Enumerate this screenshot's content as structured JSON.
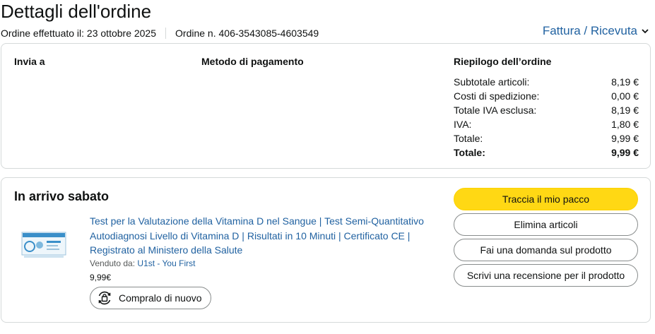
{
  "page": {
    "title": "Dettagli dell'ordine",
    "order_date_text": "Ordine effettuato il: 23 ottobre 2025",
    "order_number_text": "Ordine n. 406-3543085-4603549",
    "invoice_link": "Fattura / Ricevuta"
  },
  "summary_box": {
    "ship_to_label": "Invia a",
    "payment_label": "Metodo di pagamento",
    "summary_label": "Riepilogo dell’ordine",
    "lines": [
      {
        "label": "Subtotale articoli:",
        "value": "8,19 €"
      },
      {
        "label": "Costi di spedizione:",
        "value": "0,00 €"
      },
      {
        "label": "Totale IVA esclusa:",
        "value": "8,19 €"
      },
      {
        "label": "IVA:",
        "value": "1,80 €"
      },
      {
        "label": "Totale:",
        "value": "9,99 €"
      },
      {
        "label": "Totale:",
        "value": "9,99 €"
      }
    ]
  },
  "shipment": {
    "arrival_text": "In arrivo sabato",
    "product_title": "Test per la Valutazione della Vitamina D nel Sangue | Test Semi-Quantitativo Autodiagnosi Livello di Vitamina D | Risultati in 10 Minuti | Certificato CE | Registrato al Ministero della Salute",
    "sold_by_label": "Venduto da:",
    "seller_name": "U1st - You First",
    "price": "9,99€",
    "buy_again_label": "Compralo di nuovo",
    "actions": {
      "track": "Traccia il mio pacco",
      "remove": "Elimina articoli",
      "ask": "Fai una domanda sul prodotto",
      "review": "Scrivi una recensione per il prodotto"
    }
  },
  "colors": {
    "link": "#2162a1",
    "primary_button": "#ffd814",
    "border": "#d5d9d9"
  },
  "icons": {
    "invoice_chevron": "chevron-down-icon",
    "buy_again": "buy-again-icon"
  }
}
